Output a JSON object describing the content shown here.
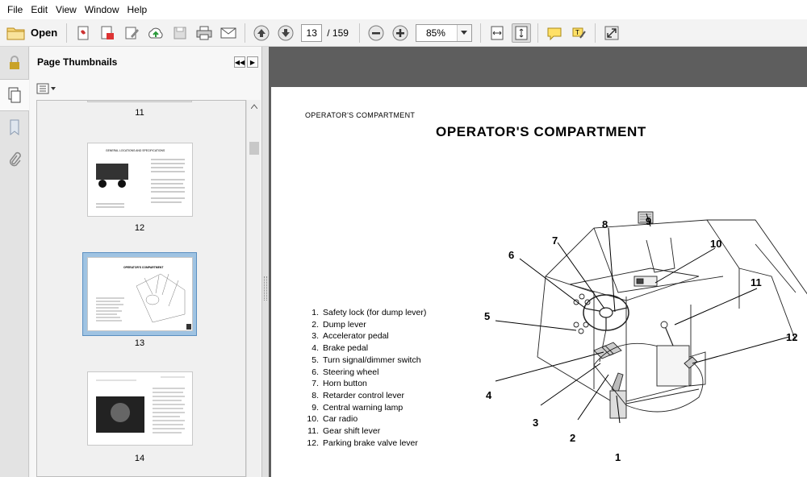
{
  "menu": [
    "File",
    "Edit",
    "View",
    "Window",
    "Help"
  ],
  "toolbar": {
    "open_label": "Open",
    "current_page": "13",
    "total_pages": "/ 159",
    "zoom": "85%"
  },
  "sidebar": {
    "title": "Page Thumbnails",
    "thumbnails": [
      {
        "label": "11"
      },
      {
        "label": "12",
        "heading": "GENERAL LOCATIONS AND SPECIFICATIONS"
      },
      {
        "label": "13",
        "heading": "OPERATOR'S COMPARTMENT"
      },
      {
        "label": "14"
      }
    ]
  },
  "document": {
    "header": "OPERATOR'S COMPARTMENT",
    "title": "OPERATOR'S COMPARTMENT",
    "legend": [
      {
        "num": "1.",
        "text": "Safety lock (for dump lever)"
      },
      {
        "num": "2.",
        "text": "Dump lever"
      },
      {
        "num": "3.",
        "text": "Accelerator pedal"
      },
      {
        "num": "4.",
        "text": "Brake pedal"
      },
      {
        "num": "5.",
        "text": "Turn signal/dimmer switch"
      },
      {
        "num": "6.",
        "text": "Steering wheel"
      },
      {
        "num": "7.",
        "text": "Horn button"
      },
      {
        "num": "8.",
        "text": "Retarder control lever"
      },
      {
        "num": "9.",
        "text": "Central warning lamp"
      },
      {
        "num": "10.",
        "text": "Car radio"
      },
      {
        "num": "11.",
        "text": "Gear shift lever"
      },
      {
        "num": "12.",
        "text": "Parking brake valve lever"
      }
    ],
    "callouts": [
      "1",
      "2",
      "3",
      "4",
      "5",
      "6",
      "7",
      "8",
      "9",
      "10",
      "11",
      "12"
    ]
  }
}
